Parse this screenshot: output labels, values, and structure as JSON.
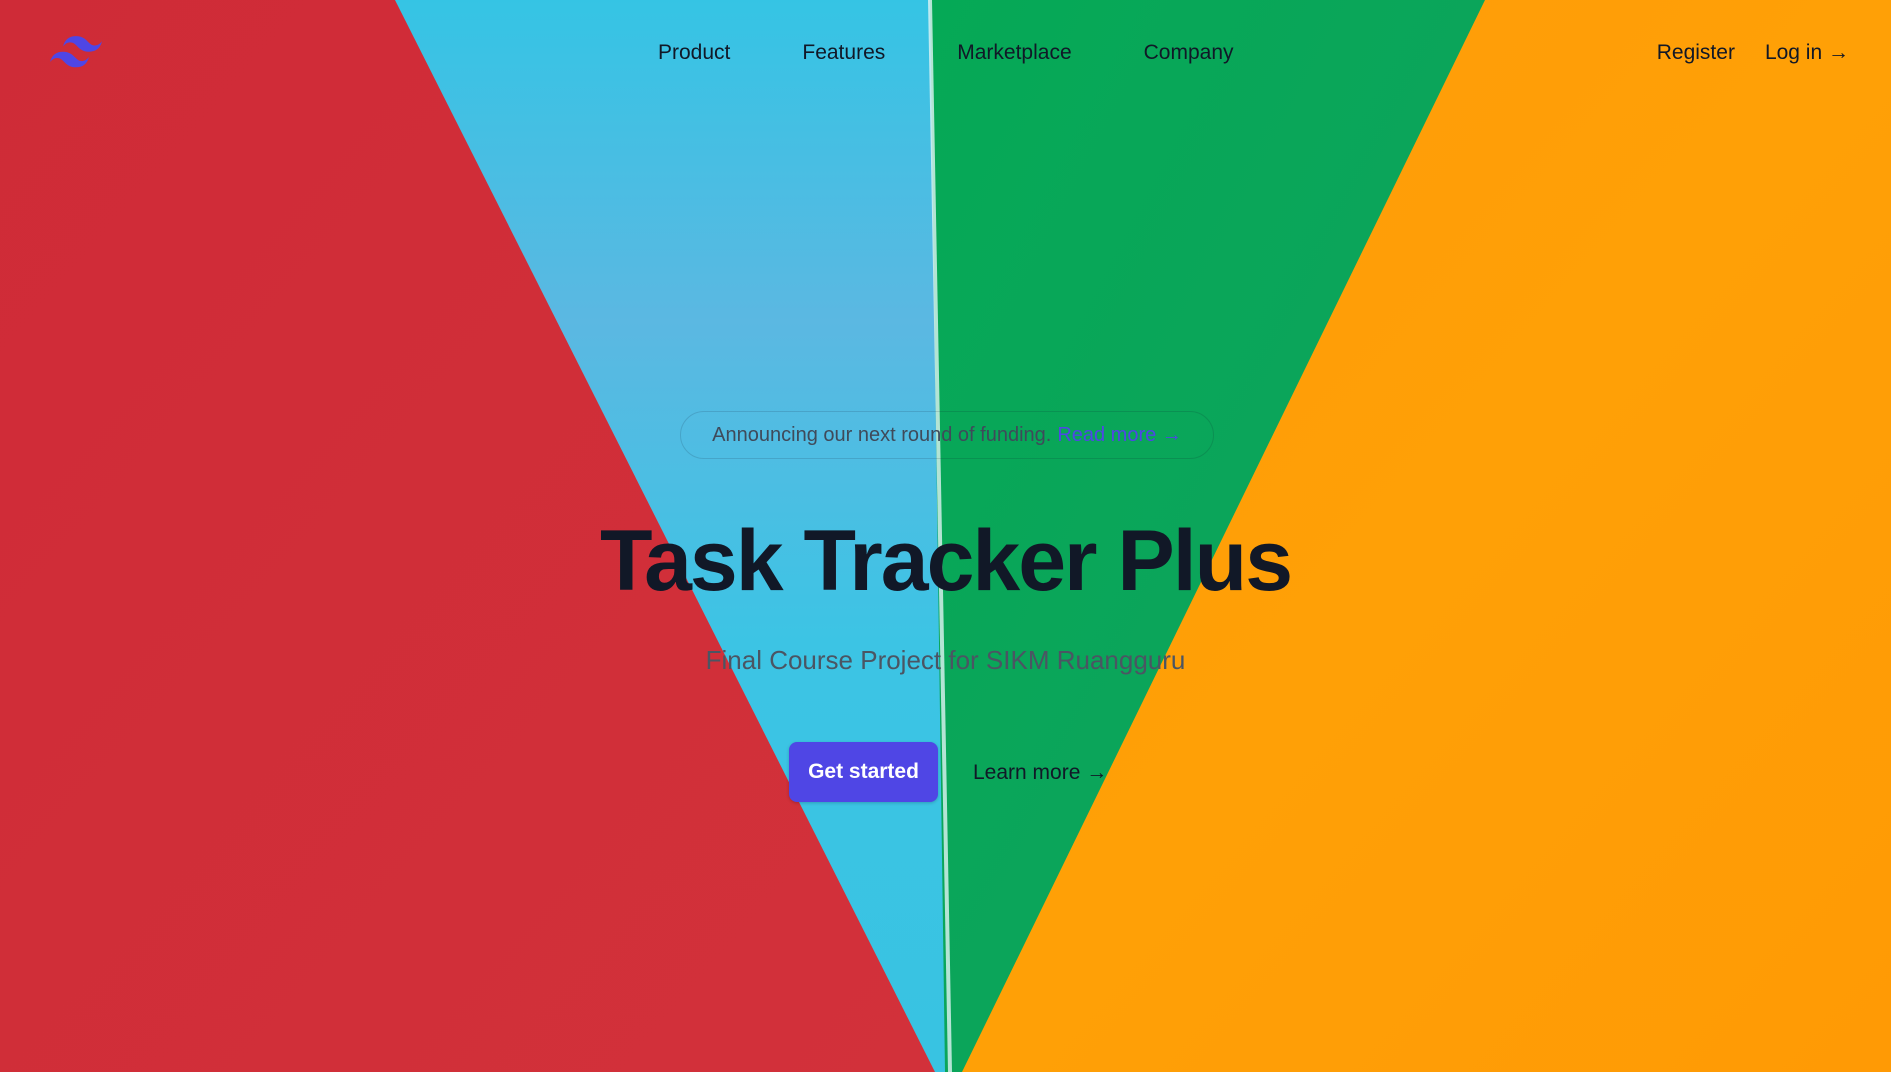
{
  "colors": {
    "accent": "#4f46e5",
    "red_panel": "#d1303a",
    "blue_panel": "#3cc4e4",
    "green_panel": "#08a852",
    "orange_panel": "#ff9a06",
    "text_dark": "#111827",
    "text_muted": "#4b5563"
  },
  "header": {
    "logo_icon": "tailwind-wave-logo-icon",
    "nav": [
      "Product",
      "Features",
      "Marketplace",
      "Company"
    ],
    "register_label": "Register",
    "login_label": "Log in →"
  },
  "hero": {
    "announcement_text": "Announcing our next round of funding.",
    "announcement_link": "Read more →",
    "title": "Task Tracker Plus",
    "subtitle": "Final Course Project for SIKM Ruangguru",
    "cta_label": "Get started",
    "learn_more_label": "Learn more →"
  }
}
